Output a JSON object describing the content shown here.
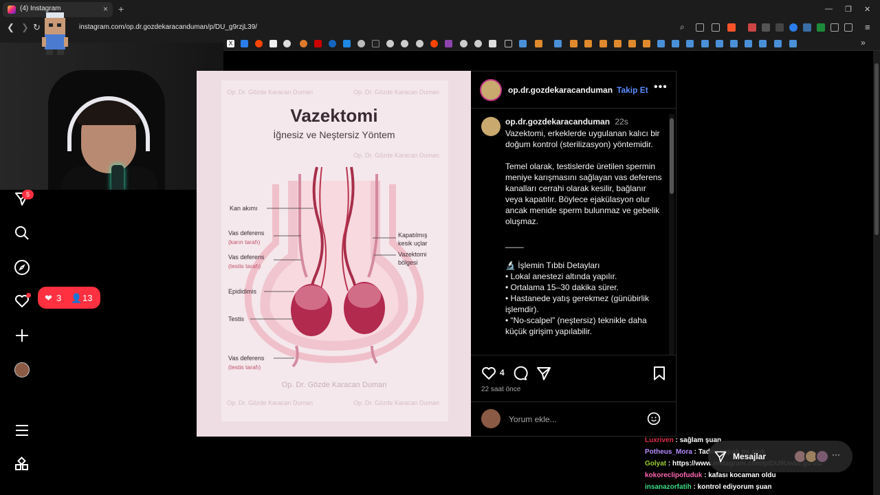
{
  "browser": {
    "tab_title": "(4) Instagram",
    "url": "instagram.com/op.dr.gozdekaracanduman/p/DU_g9rzjL39/"
  },
  "sidebar": {
    "notifications_badge": "5",
    "activity_likes": "3",
    "activity_follows": "13"
  },
  "post": {
    "username": "op.dr.gozdekaracanduman",
    "follow_label": "Takip Et",
    "caption_time": "22s",
    "caption": "Vazektomi, erkeklerde uygulanan kalıcı bir doğum kontrol (sterilizasyon) yöntemidir.\n\nTemel olarak, testislerde üretilen spermin meniye karışmasını sağlayan vas deferens kanalları cerrahi olarak kesilir, bağlanır veya kapatılır. Böylece ejakülasyon olur ancak menide sperm bulunmaz ve gebelik oluşmaz.\n\n____\n\n🔬 İşlemin Tıbbi Detayları\n\t•\tLokal anestezi altında yapılır.\n\t•\tOrtalama 15–30 dakika sürer.\n\t•\tHastanede yatış gerekmez (günübirlik işlemdir).\n\t•\t“No-scalpel” (neştersiz) teknikle daha küçük girişim yapılabilir.",
    "likes": "4",
    "posted_ago": "22 saat önce",
    "comment_placeholder": "Yorum ekle..."
  },
  "infographic": {
    "title": "Vazektomi",
    "subtitle": "İğnesiz ve Neştersiz Yöntem",
    "watermark": "Op. Dr. Gözde Karacan Duman",
    "labels": {
      "kan_akimi": "Kan akımı",
      "vas_karin_1": "Vas deferens",
      "vas_karin_2": "(karın tarafı)",
      "vas_testis_1": "Vas deferens",
      "vas_testis_2": "(testis tarafı)",
      "epididimis": "Epididimis",
      "testis": "Testis",
      "vas_bottom_1": "Vas deferens",
      "vas_bottom_2": "(testis tarafı)",
      "kapatilmis_1": "Kapatılmış",
      "kapatilmis_2": "kesik uçlar",
      "vazektomi_1": "Vazektomi",
      "vazektomi_2": "bölgesi"
    }
  },
  "messages": {
    "label": "Mesajlar"
  },
  "chat": [
    {
      "user": "Luxriven",
      "text": " : sağlam şuan",
      "color": "#e0304a"
    },
    {
      "user": "Potheus_Mora",
      "text": " : Tadını yapak mı amk",
      "color": "#b58cff"
    },
    {
      "user": "Golyat",
      "text": " : https://www.instagram.com/p/DU9UwWrgUVu/",
      "color": "#9acd32"
    },
    {
      "user": "kokoreclipofuduk",
      "text": " : kafası kocaman oldu",
      "color": "#ff69b4"
    },
    {
      "user": "insanazorfatih",
      "text": " : kontrol ediyorum şuan",
      "color": "#3ddc84"
    }
  ],
  "colors": {
    "accent_blue": "#5a8cff",
    "notification_red": "#ff3040",
    "infographic_bg": "#f2e1e6",
    "organ_red": "#b8324e"
  },
  "icons": [
    "back-icon",
    "forward-icon",
    "reload-icon",
    "heart-icon",
    "comment-icon",
    "share-icon",
    "bookmark-icon",
    "search-icon",
    "explore-icon",
    "plus-icon",
    "menu-icon",
    "apps-icon",
    "emoji-icon",
    "more-icon"
  ]
}
